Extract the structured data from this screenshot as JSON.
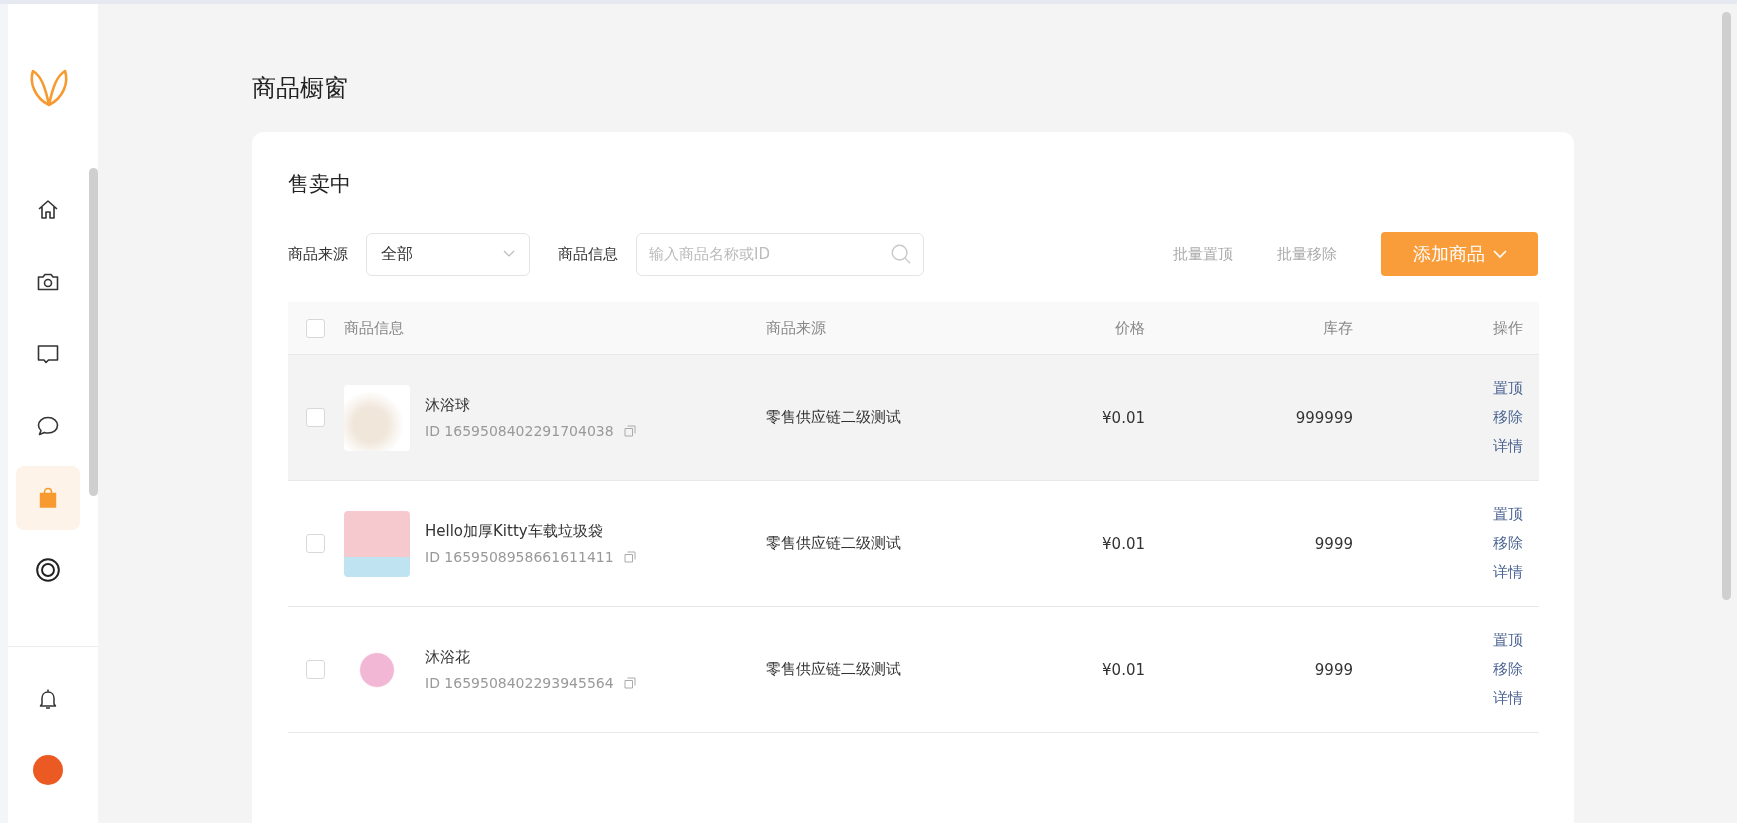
{
  "sidebar": {
    "items": [
      {
        "selected": false
      },
      {
        "selected": false
      },
      {
        "selected": false
      },
      {
        "selected": false
      },
      {
        "selected": true
      },
      {
        "selected": false
      }
    ]
  },
  "page_title": "商品橱窗",
  "card": {
    "title": "售卖中",
    "filters": {
      "source_label": "商品来源",
      "source_value": "全部",
      "info_label": "商品信息",
      "search": {
        "placeholder": "输入商品名称或ID"
      }
    },
    "batch_actions": [
      "批量置顶",
      "批量移除"
    ],
    "add_button": "添加商品",
    "table": {
      "columns": [
        "商品信息",
        "商品来源",
        "价格",
        "库存",
        "操作"
      ],
      "all_checked": false,
      "rows": [
        {
          "checked": false,
          "hovered": true,
          "name": "沐浴球",
          "id": "ID 1659508402291704038",
          "source": "零售供应链二级测试",
          "price": "¥0.01",
          "stock": "999999",
          "actions": [
            "置顶",
            "移除",
            "详情"
          ]
        },
        {
          "checked": false,
          "hovered": false,
          "name": "Hello加厚Kitty车载垃圾袋",
          "id": "ID 1659508958661611411",
          "source": "零售供应链二级测试",
          "price": "¥0.01",
          "stock": "9999",
          "actions": [
            "置顶",
            "移除",
            "详情"
          ]
        },
        {
          "checked": false,
          "hovered": false,
          "name": "沐浴花",
          "id": "ID 1659508402293945564",
          "source": "零售供应链二级测试",
          "price": "¥0.01",
          "stock": "9999",
          "actions": [
            "置顶",
            "移除",
            "详情"
          ]
        }
      ]
    }
  }
}
